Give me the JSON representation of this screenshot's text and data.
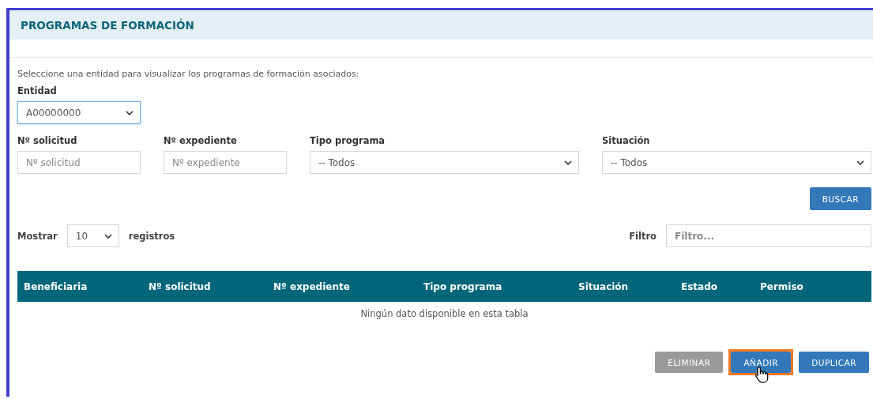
{
  "panel": {
    "title": "PROGRAMAS DE FORMACIÓN"
  },
  "instruction": "Seleccione una entidad para visualizar los programas de formación asociados:",
  "entity": {
    "label": "Entidad",
    "value": "A00000000"
  },
  "filters": [
    {
      "kind": "input",
      "label": "Nº solicitud",
      "placeholder": "Nº solicitud"
    },
    {
      "kind": "input",
      "label": "Nº expediente",
      "placeholder": "Nº expediente"
    },
    {
      "kind": "select",
      "label": "Tipo programa",
      "value": "-- Todos"
    },
    {
      "kind": "select",
      "label": "Situación",
      "value": "-- Todos"
    }
  ],
  "search_button": "BUSCAR",
  "page_size": {
    "before": "Mostrar",
    "value": "10",
    "after": "registros"
  },
  "filter": {
    "label": "Filtro",
    "placeholder": "Filtro..."
  },
  "table": {
    "columns": [
      "Beneficiaria",
      "Nº solicitud",
      "Nº expediente",
      "Tipo programa",
      "Situación",
      "Estado",
      "Permiso"
    ],
    "empty_message": "Ningún dato disponible en esta tabla"
  },
  "actions": [
    {
      "label": "ELIMINAR",
      "disabled": true,
      "highlighted": false
    },
    {
      "label": "AÑADIR",
      "disabled": false,
      "highlighted": true
    },
    {
      "label": "DUPLICAR",
      "disabled": false,
      "highlighted": false
    }
  ]
}
